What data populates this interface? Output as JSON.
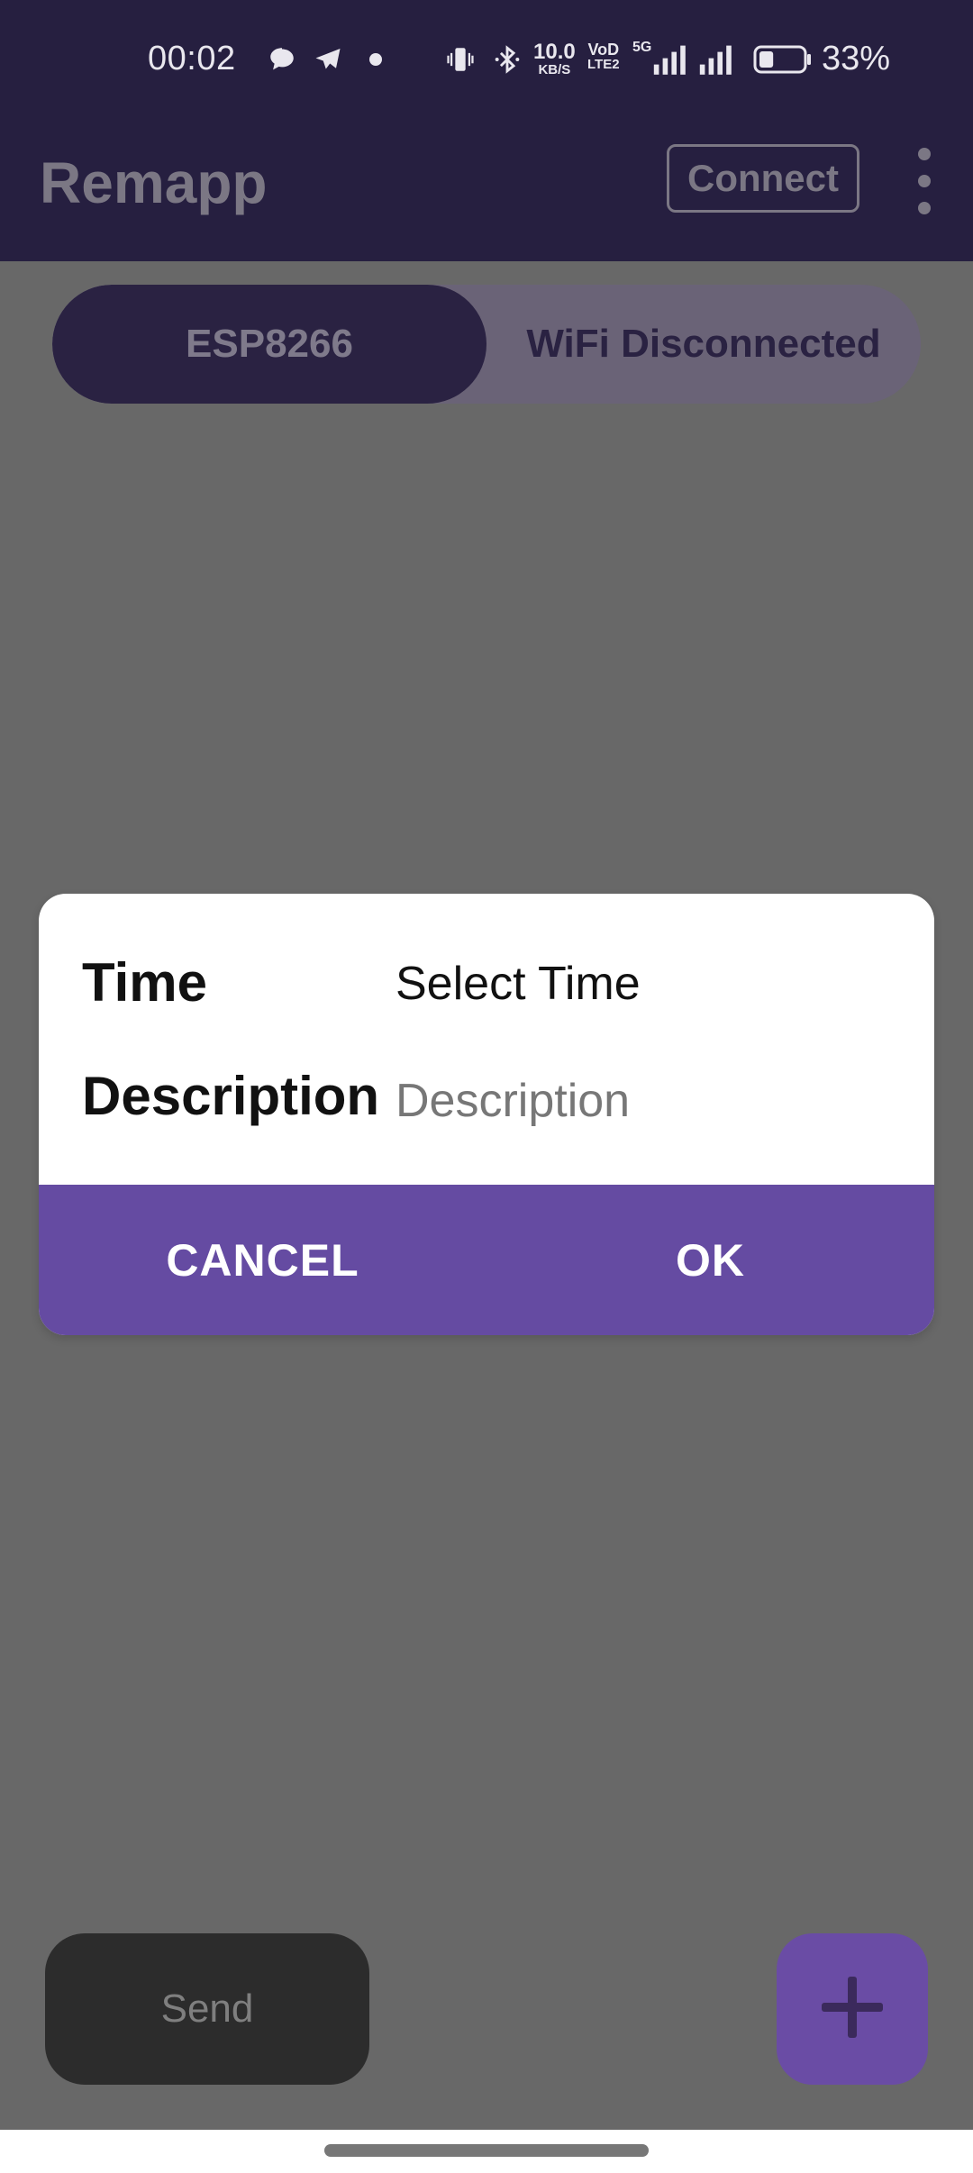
{
  "status_bar": {
    "time": "00:02",
    "speed_value": "10.0",
    "speed_unit": "KB/S",
    "volte_top": "VoD",
    "volte_bottom": "LTE2",
    "network_type": "5G",
    "battery_percent": "33%",
    "battery_level": 0.33,
    "icons": [
      "chat-bubble-icon",
      "telegram-icon",
      "dot-icon",
      "vibrate-icon",
      "bluetooth-icon",
      "signal-icon",
      "signal-icon",
      "battery-icon"
    ]
  },
  "app_bar": {
    "title": "Remapp",
    "connect_label": "Connect",
    "menu_icon": "more-vert-icon"
  },
  "segment": {
    "left_label": "ESP8266",
    "right_label": "WiFi Disconnected"
  },
  "dialog": {
    "time_label": "Time",
    "time_value": "Select Time",
    "description_label": "Description",
    "description_placeholder": "Description",
    "description_value": "",
    "cancel_label": "CANCEL",
    "ok_label": "OK"
  },
  "bottom": {
    "send_label": "Send",
    "add_icon": "plus-icon"
  },
  "colors": {
    "app_bar": "#261f40",
    "dialog_actions": "#654ba2",
    "fab": "#6a4ca5",
    "scrim": "#686868"
  }
}
